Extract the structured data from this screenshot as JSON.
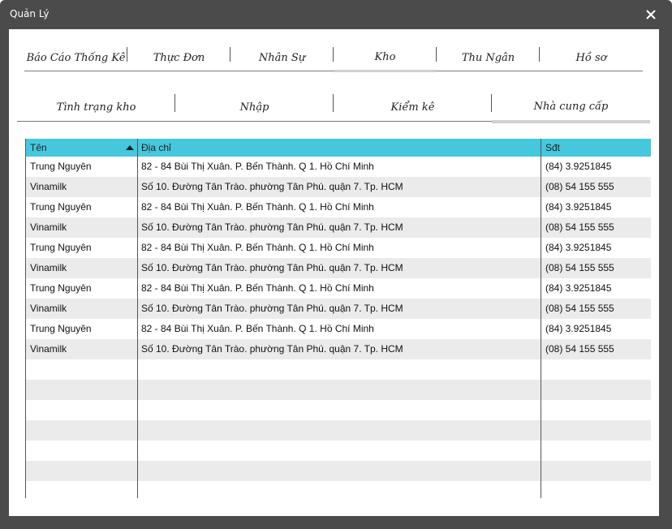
{
  "window": {
    "title": "Quản Lý"
  },
  "main_tabs": [
    {
      "label": "Báo Cáo Thống Kê"
    },
    {
      "label": "Thực Đơn"
    },
    {
      "label": "Nhân Sự"
    },
    {
      "label": "Kho"
    },
    {
      "label": "Thu Ngân"
    },
    {
      "label": "Hồ sơ"
    }
  ],
  "sub_tabs": [
    {
      "label": "Tình trạng kho"
    },
    {
      "label": "Nhập"
    },
    {
      "label": "Kiểm kê"
    },
    {
      "label": "Nhà cung cấp"
    }
  ],
  "grid": {
    "columns": [
      "Tên",
      "Địa chỉ",
      "Sđt"
    ],
    "rows": [
      [
        "Trung Nguyên",
        "82 - 84 Bùi Thị Xuân. P. Bến Thành. Q 1. Hồ Chí Minh",
        "(84) 3.9251845"
      ],
      [
        "Vinamilk",
        "Số 10. Đường Tân Trào. phường Tân Phú. quận 7. Tp. HCM",
        "(08) 54 155 555"
      ],
      [
        "Trung Nguyên",
        "82 - 84 Bùi Thị Xuân. P. Bến Thành. Q 1. Hồ Chí Minh",
        "(84) 3.9251845"
      ],
      [
        "Vinamilk",
        "Số 10. Đường Tân Trào. phường Tân Phú. quận 7. Tp. HCM",
        "(08) 54 155 555"
      ],
      [
        "Trung Nguyên",
        "82 - 84 Bùi Thị Xuân. P. Bến Thành. Q 1. Hồ Chí Minh",
        "(84) 3.9251845"
      ],
      [
        "Vinamilk",
        "Số 10. Đường Tân Trào. phường Tân Phú. quận 7. Tp. HCM",
        "(08) 54 155 555"
      ],
      [
        "Trung Nguyên",
        "82 - 84 Bùi Thị Xuân. P. Bến Thành. Q 1. Hồ Chí Minh",
        "(84) 3.9251845"
      ],
      [
        "Vinamilk",
        "Số 10. Đường Tân Trào. phường Tân Phú. quận 7. Tp. HCM",
        "(08) 54 155 555"
      ],
      [
        "Trung Nguyên",
        "82 - 84 Bùi Thị Xuân. P. Bến Thành. Q 1. Hồ Chí Minh",
        "(84) 3.9251845"
      ],
      [
        "Vinamilk",
        "Số 10. Đường Tân Trào. phường Tân Phú. quận 7. Tp. HCM",
        "(08) 54 155 555"
      ],
      [
        "",
        "",
        ""
      ],
      [
        "",
        "",
        ""
      ],
      [
        "",
        "",
        ""
      ],
      [
        "",
        "",
        ""
      ],
      [
        "",
        "",
        ""
      ],
      [
        "",
        "",
        ""
      ],
      [
        "",
        "",
        ""
      ]
    ]
  },
  "colors": {
    "header_bg": "#45c8de",
    "alt_row": "#ebebeb",
    "window_frame": "#4b4b4b"
  }
}
